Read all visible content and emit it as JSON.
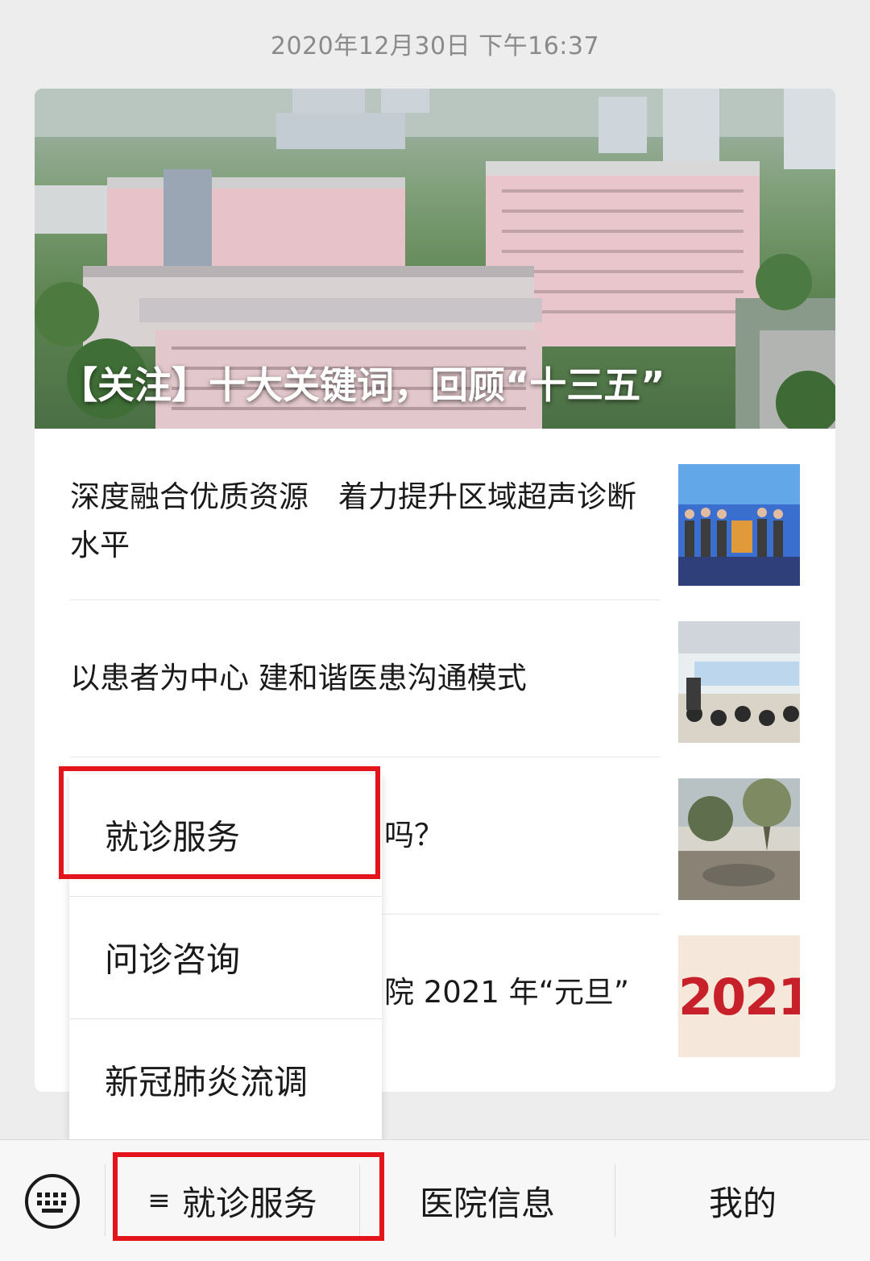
{
  "timestamp": "2020年12月30日 下午16:37",
  "hero": {
    "title": "【关注】十大关键词，回顾“十三五”"
  },
  "articles": [
    {
      "title": "深度融合优质资源　着力提升区域超声诊断水平"
    },
    {
      "title": "以患者为中心 建和谐医患沟通模式"
    },
    {
      "title_partial": "吗？"
    },
    {
      "title_partial": "院 2021 年“元旦”"
    }
  ],
  "thumb_text": "2021",
  "popup_menu": {
    "items": [
      {
        "label": "就诊服务"
      },
      {
        "label": "问诊咨询"
      },
      {
        "label": "新冠肺炎流调"
      }
    ]
  },
  "bottom_menu": {
    "keyboard_icon": "keyboard-icon",
    "tabs": [
      {
        "label": "就诊服务",
        "icon": "≡"
      },
      {
        "label": "医院信息"
      },
      {
        "label": "我的"
      }
    ]
  },
  "colors": {
    "highlight": "#e4151a",
    "background": "#ededed"
  }
}
